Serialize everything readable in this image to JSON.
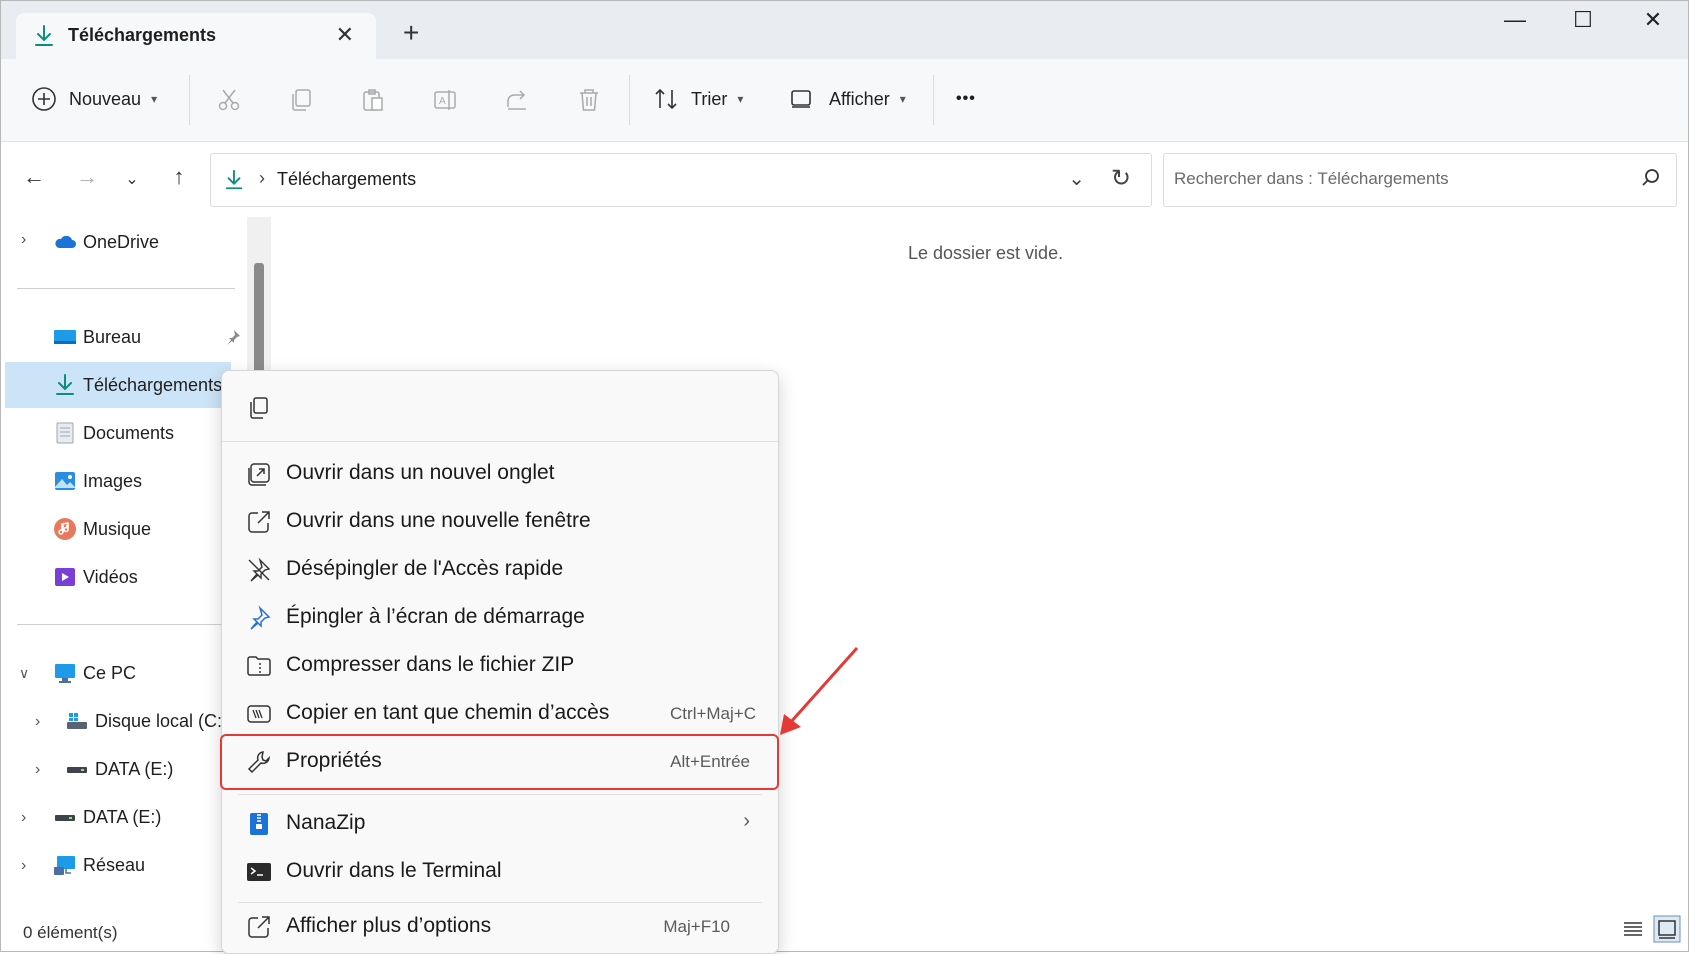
{
  "colors": {
    "accent": "#0f8c7e",
    "highlight": "#e53935",
    "selection": "#cce4f7"
  },
  "tab": {
    "title": "Téléchargements",
    "close": "✕",
    "new": "+"
  },
  "window": {
    "minimize": "—",
    "maximize": "☐",
    "close": "✕"
  },
  "toolbar": {
    "new_label": "Nouveau",
    "sort_label": "Trier",
    "view_label": "Afficher",
    "more_label": "•••"
  },
  "address": {
    "path": "Téléchargements",
    "separator": "›"
  },
  "search": {
    "placeholder": "Rechercher dans : Téléchargements"
  },
  "sidebar": {
    "onedrive": "OneDrive",
    "quick": [
      {
        "label": "Bureau"
      },
      {
        "label": "Téléchargements"
      },
      {
        "label": "Documents"
      },
      {
        "label": "Images"
      },
      {
        "label": "Musique"
      },
      {
        "label": "Vidéos"
      }
    ],
    "this_pc": "Ce PC",
    "local_disk": "Disque local (C:)",
    "data_e_nested": "DATA (E:)",
    "data_e": "DATA (E:)",
    "network": "Réseau"
  },
  "content": {
    "empty_message": "Le dossier est vide."
  },
  "status": {
    "count": "0 élément(s)"
  },
  "context_menu": {
    "items": [
      {
        "label": "Ouvrir dans un nouvel onglet",
        "shortcut": ""
      },
      {
        "label": "Ouvrir dans une nouvelle fenêtre",
        "shortcut": ""
      },
      {
        "label": "Désépingler de l'Accès rapide",
        "shortcut": ""
      },
      {
        "label": "Épingler à l’écran de démarrage",
        "shortcut": ""
      },
      {
        "label": "Compresser dans le fichier ZIP",
        "shortcut": ""
      },
      {
        "label": "Copier en tant que chemin d’accès",
        "shortcut": "Ctrl+Maj+C"
      },
      {
        "label": "Propriétés",
        "shortcut": "Alt+Entrée"
      },
      {
        "label": "NanaZip",
        "shortcut": ""
      },
      {
        "label": "Ouvrir dans le Terminal",
        "shortcut": ""
      },
      {
        "label": "Afficher plus d’options",
        "shortcut": "Maj+F10"
      }
    ]
  }
}
